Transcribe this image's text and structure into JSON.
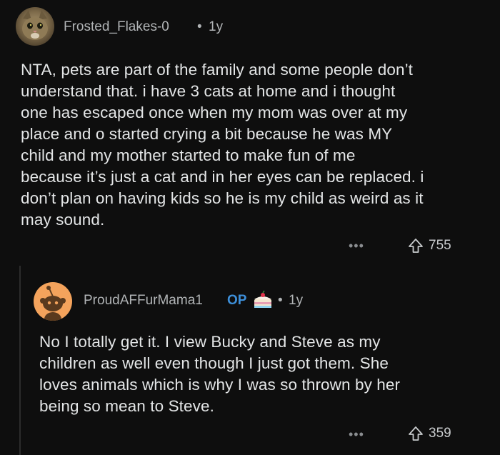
{
  "comment": {
    "username": "Frosted_Flakes-0",
    "separator": "•",
    "age": "1y",
    "lines": [
      "NTA, pets are part of the family and some people don’t",
      "understand that. i have 3 cats at home and i thought",
      "one has escaped once when my mom was over at my",
      "place and o started crying a bit because he was MY",
      "child and my mother started to make fun of me",
      "because it’s just a cat and in her eyes can be replaced. i",
      "don’t plan on having kids so he is my child as weird as it",
      "may sound."
    ],
    "more": "•••",
    "votes": "755"
  },
  "reply": {
    "username": "ProudAFFurMama1",
    "op_badge": "OP",
    "separator": "•",
    "age": "1y",
    "lines": [
      "No I totally get it. I view Bucky and Steve as my",
      "children as well even though I just got them. She",
      "loves animals which is why I was so thrown by her",
      "being so mean to Steve."
    ],
    "more": "•••",
    "votes": "359"
  },
  "colors": {
    "background": "#0e0e0e",
    "text": "#e3e5e6",
    "meta": "#b0b3b5",
    "op": "#3d8fd9",
    "snoo_bg": "#f4a35c"
  },
  "icons": [
    "cat-avatar-icon",
    "snoo-avatar-icon",
    "cake-flair-icon",
    "upvote-arrow-icon",
    "more-options-icon"
  ]
}
